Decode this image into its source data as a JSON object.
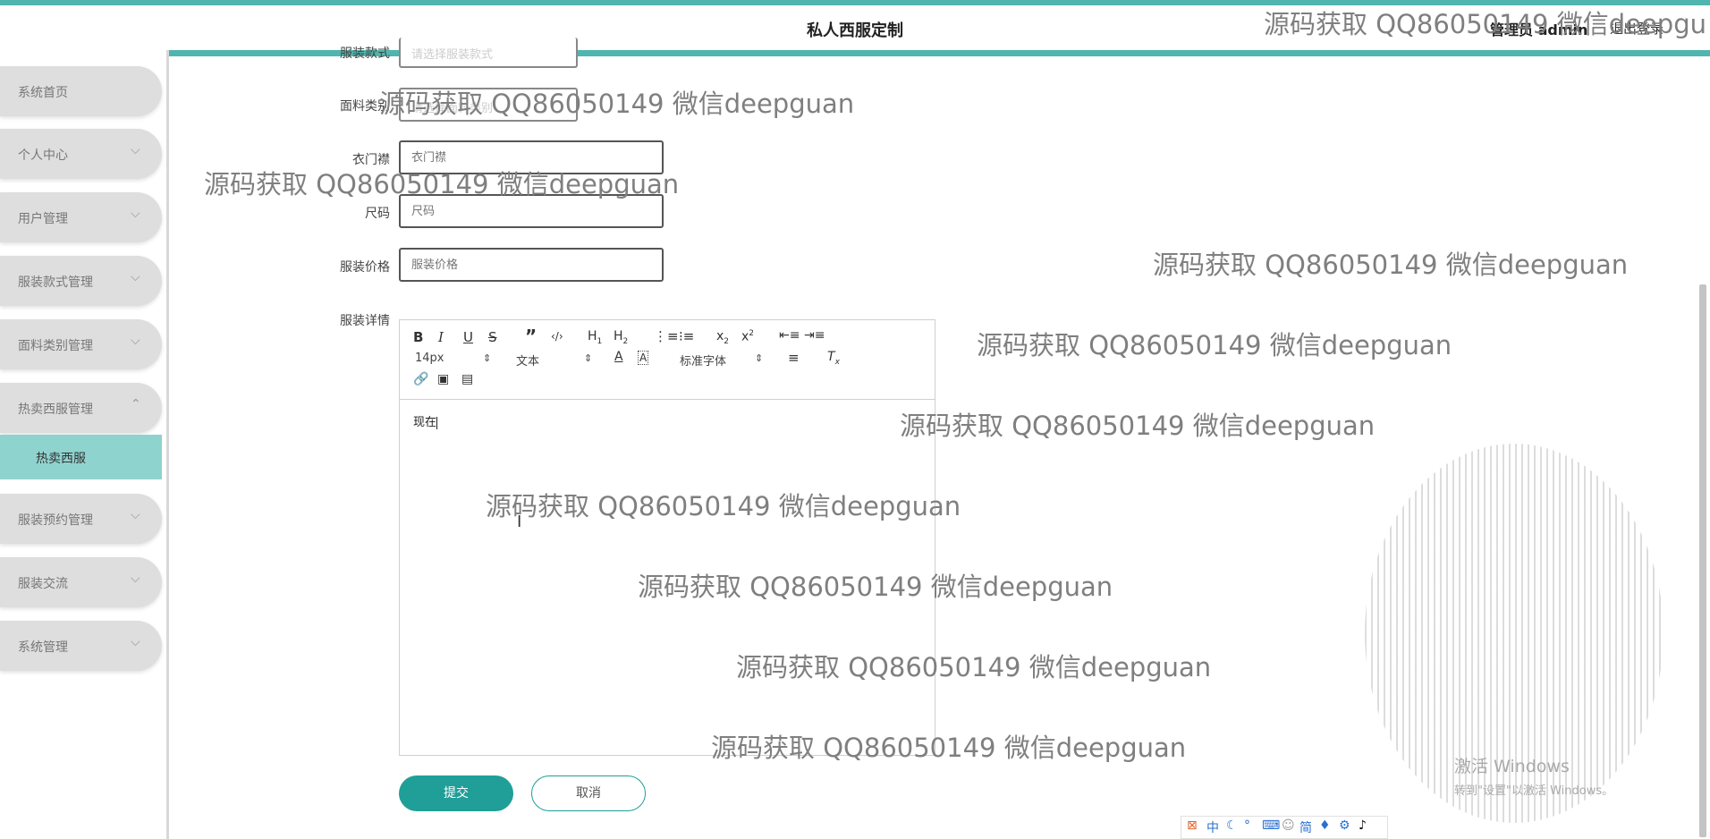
{
  "header": {
    "title": "私人西服定制",
    "user": "管理员 admin",
    "logout": "退出登录"
  },
  "sidebar": {
    "items": [
      {
        "label": "系统首页"
      },
      {
        "label": "个人中心"
      },
      {
        "label": "用户管理"
      },
      {
        "label": "服装款式管理"
      },
      {
        "label": "面料类别管理"
      },
      {
        "label": "热卖西服管理"
      },
      {
        "label": "服装预约管理"
      },
      {
        "label": "服装交流"
      },
      {
        "label": "系统管理"
      }
    ],
    "sub_active": "热卖西服"
  },
  "form": {
    "style_label": "服装款式",
    "style_placeholder": "请选择服装款式",
    "fabric_label": "面料类别",
    "fabric_placeholder": "请选择面料类别",
    "placket_label": "衣门襟",
    "placket_placeholder": "衣门襟",
    "size_label": "尺码",
    "size_placeholder": "尺码",
    "price_label": "服装价格",
    "price_placeholder": "服装价格",
    "detail_label": "服装详情"
  },
  "editor": {
    "font_size": "14px",
    "text_type": "文本",
    "font_family": "标准字体",
    "content": "现在"
  },
  "buttons": {
    "submit": "提交",
    "cancel": "取消"
  },
  "watermark": "源码获取 QQ86050149 微信deepguan",
  "watermark_partial": "源码获取 QQ86050149 微信deepgu",
  "os": {
    "activate_title": "激活 Windows",
    "activate_sub": "转到\"设置\"以激活 Windows。"
  },
  "ime_tray": {
    "mode": "中",
    "simplified": "简"
  }
}
